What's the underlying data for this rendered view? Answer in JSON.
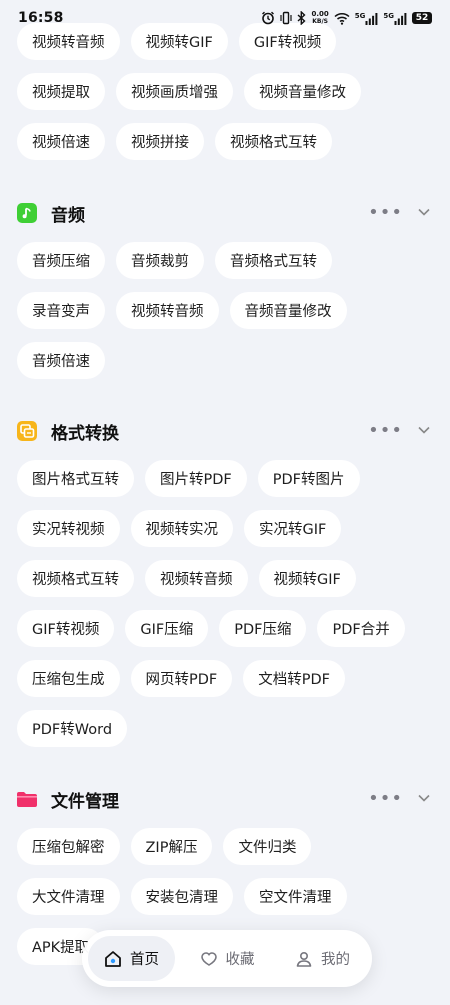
{
  "status_bar": {
    "time": "16:58",
    "net_speed_value": "0.00",
    "net_speed_unit": "KB/S",
    "signal_1_label": "5G",
    "signal_2_label": "5G",
    "battery": "52"
  },
  "video_rows": [
    [
      "视频转音频",
      "视频转GIF",
      "GIF转视频"
    ],
    [
      "视频提取",
      "视频画质增强",
      "视频音量修改"
    ],
    [
      "视频倍速",
      "视频拼接",
      "视频格式互转"
    ]
  ],
  "audio": {
    "title": "音频",
    "icon_color": "#3fcf35",
    "rows": [
      [
        "音频压缩",
        "音频裁剪",
        "音频格式互转"
      ],
      [
        "录音变声",
        "视频转音频",
        "音频音量修改"
      ],
      [
        "音频倍速"
      ]
    ]
  },
  "format": {
    "title": "格式转换",
    "icon_color": "#f7b51b",
    "rows": [
      [
        "图片格式互转",
        "图片转PDF",
        "PDF转图片"
      ],
      [
        "实况转视频",
        "视频转实况",
        "实况转GIF"
      ],
      [
        "视频格式互转",
        "视频转音频",
        "视频转GIF"
      ],
      [
        "GIF转视频",
        "GIF压缩",
        "PDF压缩",
        "PDF合并"
      ],
      [
        "压缩包生成",
        "网页转PDF",
        "文档转PDF"
      ],
      [
        "PDF转Word"
      ]
    ]
  },
  "files": {
    "title": "文件管理",
    "icon_color": "#f0306a",
    "rows": [
      [
        "压缩包解密",
        "ZIP解压",
        "文件归类"
      ],
      [
        "大文件清理",
        "安装包清理",
        "空文件清理"
      ],
      [
        "APK提取"
      ]
    ]
  },
  "section_more_label": "•••",
  "tabbar": {
    "home": "首页",
    "favorites": "收藏",
    "mine": "我的"
  }
}
